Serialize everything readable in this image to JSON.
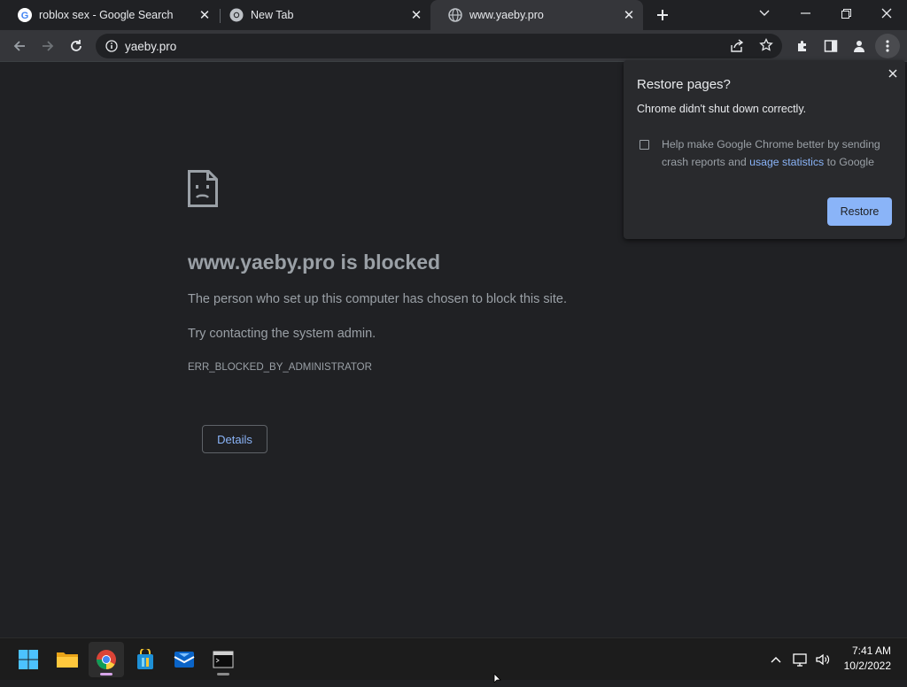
{
  "tabs": [
    {
      "title": "roblox sex - Google Search",
      "favicon": "google-icon"
    },
    {
      "title": "New Tab",
      "favicon": "chrome-icon"
    },
    {
      "title": "www.yaeby.pro",
      "favicon": "globe-icon",
      "active": true
    }
  ],
  "toolbar": {
    "url": "yaeby.pro"
  },
  "page": {
    "title": "www.yaeby.pro is blocked",
    "line1": "The person who set up this computer has chosen to block this site.",
    "line2": "Try contacting the system admin.",
    "error_code": "ERR_BLOCKED_BY_ADMINISTRATOR",
    "details_label": "Details"
  },
  "bubble": {
    "title": "Restore pages?",
    "subtitle": "Chrome didn't shut down correctly.",
    "checkbox_text_before": "Help make Google Chrome better by sending crash reports and",
    "checkbox_link": "usage statistics",
    "checkbox_text_after": "to Google",
    "checked": false,
    "restore_label": "Restore"
  },
  "taskbar": {
    "apps": [
      "start-icon",
      "file-explorer-icon",
      "chrome-icon",
      "store-icon",
      "mail-icon",
      "terminal-icon"
    ],
    "time": "7:41 AM",
    "date": "10/2/2022"
  },
  "colors": {
    "accent": "#8ab4f8",
    "page_bg": "#202124",
    "toolbar_bg": "#35363a"
  }
}
